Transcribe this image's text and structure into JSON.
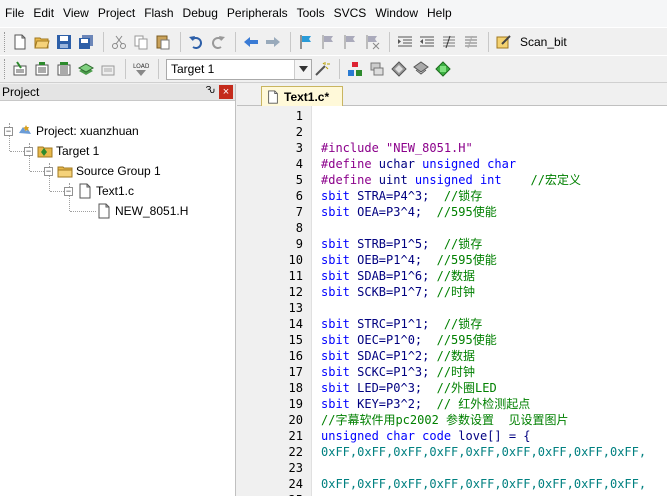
{
  "menu": [
    "File",
    "Edit",
    "View",
    "Project",
    "Flash",
    "Debug",
    "Peripherals",
    "Tools",
    "SVCS",
    "Window",
    "Help"
  ],
  "toolbar1": {
    "scan_label": "Scan_bit"
  },
  "toolbar2": {
    "target_value": "Target 1"
  },
  "project_panel": {
    "title": "Project",
    "pin": "Ԅ",
    "close": "×",
    "tree": {
      "project": "Project: xuanzhuan",
      "target": "Target 1",
      "group": "Source Group 1",
      "file": "Text1.c",
      "header": "NEW_8051.H"
    }
  },
  "editor": {
    "tab_label": "Text1.c*",
    "lines": [
      {
        "n": "1",
        "parts": []
      },
      {
        "n": "2",
        "parts": []
      },
      {
        "n": "3",
        "parts": [
          {
            "t": "#include ",
            "c": "pp"
          },
          {
            "t": "\"NEW_8051.H\"",
            "c": "str"
          }
        ]
      },
      {
        "n": "4",
        "parts": [
          {
            "t": "#define ",
            "c": "pp"
          },
          {
            "t": "uchar ",
            "c": "tx"
          },
          {
            "t": "unsigned char",
            "c": "kw"
          }
        ]
      },
      {
        "n": "5",
        "parts": [
          {
            "t": "#define ",
            "c": "pp"
          },
          {
            "t": "uint ",
            "c": "tx"
          },
          {
            "t": "unsigned int",
            "c": "kw"
          },
          {
            "t": "    //宏定义",
            "c": "cm"
          }
        ]
      },
      {
        "n": "6",
        "parts": [
          {
            "t": "sbit ",
            "c": "kw"
          },
          {
            "t": "STRA=P4^3;  ",
            "c": "tx"
          },
          {
            "t": "//锁存",
            "c": "cm"
          }
        ]
      },
      {
        "n": "7",
        "parts": [
          {
            "t": "sbit ",
            "c": "kw"
          },
          {
            "t": "OEA=P3^4;  ",
            "c": "tx"
          },
          {
            "t": "//595使能",
            "c": "cm"
          }
        ]
      },
      {
        "n": "8",
        "parts": []
      },
      {
        "n": "9",
        "parts": [
          {
            "t": "sbit ",
            "c": "kw"
          },
          {
            "t": "STRB=P1^5;  ",
            "c": "tx"
          },
          {
            "t": "//锁存",
            "c": "cm"
          }
        ]
      },
      {
        "n": "10",
        "parts": [
          {
            "t": "sbit ",
            "c": "kw"
          },
          {
            "t": "OEB=P1^4;  ",
            "c": "tx"
          },
          {
            "t": "//595使能",
            "c": "cm"
          }
        ]
      },
      {
        "n": "11",
        "parts": [
          {
            "t": "sbit ",
            "c": "kw"
          },
          {
            "t": "SDAB=P1^6; ",
            "c": "tx"
          },
          {
            "t": "//数据",
            "c": "cm"
          }
        ]
      },
      {
        "n": "12",
        "parts": [
          {
            "t": "sbit ",
            "c": "kw"
          },
          {
            "t": "SCKB=P1^7; ",
            "c": "tx"
          },
          {
            "t": "//时钟",
            "c": "cm"
          }
        ]
      },
      {
        "n": "13",
        "parts": []
      },
      {
        "n": "14",
        "parts": [
          {
            "t": "sbit ",
            "c": "kw"
          },
          {
            "t": "STRC=P1^1;  ",
            "c": "tx"
          },
          {
            "t": "//锁存",
            "c": "cm"
          }
        ]
      },
      {
        "n": "15",
        "parts": [
          {
            "t": "sbit ",
            "c": "kw"
          },
          {
            "t": "OEC=P1^0;  ",
            "c": "tx"
          },
          {
            "t": "//595使能",
            "c": "cm"
          }
        ]
      },
      {
        "n": "16",
        "parts": [
          {
            "t": "sbit ",
            "c": "kw"
          },
          {
            "t": "SDAC=P1^2; ",
            "c": "tx"
          },
          {
            "t": "//数据",
            "c": "cm"
          }
        ]
      },
      {
        "n": "17",
        "parts": [
          {
            "t": "sbit ",
            "c": "kw"
          },
          {
            "t": "SCKC=P1^3; ",
            "c": "tx"
          },
          {
            "t": "//时钟",
            "c": "cm"
          }
        ]
      },
      {
        "n": "18",
        "parts": [
          {
            "t": "sbit ",
            "c": "kw"
          },
          {
            "t": "LED=P0^3;  ",
            "c": "tx"
          },
          {
            "t": "//外圈LED",
            "c": "cm"
          }
        ]
      },
      {
        "n": "19",
        "parts": [
          {
            "t": "sbit ",
            "c": "kw"
          },
          {
            "t": "KEY=P3^2;  ",
            "c": "tx"
          },
          {
            "t": "// 红外检测起点",
            "c": "cm"
          }
        ]
      },
      {
        "n": "20",
        "parts": [
          {
            "t": "//字幕软件用pc2002 参数设置  见设置图片",
            "c": "cm"
          }
        ]
      },
      {
        "n": "21",
        "parts": [
          {
            "t": "unsigned char code ",
            "c": "kw"
          },
          {
            "t": "love[] = {",
            "c": "tx"
          }
        ]
      },
      {
        "n": "22",
        "parts": [
          {
            "t": "0xFF,0xFF,0xFF,0xFF,0xFF,0xFF,0xFF,0xFF,0xFF,",
            "c": "num"
          }
        ]
      },
      {
        "n": "23",
        "parts": []
      },
      {
        "n": "24",
        "parts": [
          {
            "t": "0xFF,0xFF,0xFF,0xFF,0xFF,0xFF,0xFF,0xFF,0xFF,",
            "c": "num"
          }
        ]
      },
      {
        "n": "25",
        "parts": []
      }
    ]
  },
  "colors": {
    "tab_bg": "#fff9d9",
    "keyword": "#0000ff",
    "comment": "#008000",
    "preprocessor": "#8b008b",
    "number": "#008080"
  }
}
